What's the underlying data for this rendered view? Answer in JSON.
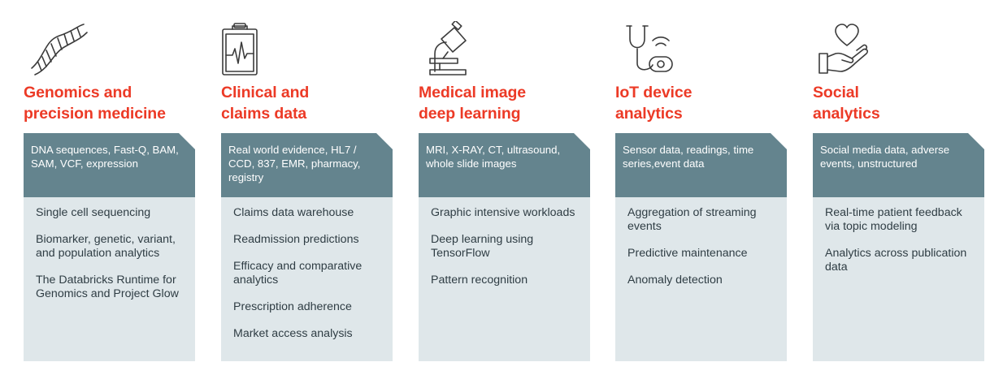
{
  "columns": [
    {
      "id": "genomics",
      "icon": "dna-icon",
      "title_line1": "Genomics and",
      "title_line2": "precision medicine",
      "data_sources": "DNA sequences, Fast-Q, BAM, SAM, VCF, expression",
      "use_cases": [
        "Single cell sequencing",
        "Biomarker, genetic, variant, and population analytics",
        "The Databricks Runtime for Genomics and Project Glow"
      ]
    },
    {
      "id": "clinical",
      "icon": "clipboard-heartbeat-icon",
      "title_line1": "Clinical and",
      "title_line2": "claims data",
      "data_sources": "Real world evidence,  HL7 / CCD, 837, EMR, pharmacy, registry",
      "use_cases": [
        "Claims data warehouse",
        "Readmission predictions",
        "Efficacy and comparative analytics",
        "Prescription adherence",
        "Market access analysis"
      ]
    },
    {
      "id": "imaging",
      "icon": "microscope-icon",
      "title_line1": "Medical image",
      "title_line2": "deep learning",
      "data_sources": "MRI, X-RAY, CT, ultrasound, whole slide images",
      "use_cases": [
        "Graphic intensive workloads",
        "Deep learning using TensorFlow",
        "Pattern recognition"
      ]
    },
    {
      "id": "iot",
      "icon": "stethoscope-wireless-icon",
      "title_line1": "IoT device",
      "title_line2": "analytics",
      "data_sources": "Sensor data, readings, time series,event data",
      "use_cases": [
        "Aggregation of streaming events",
        "Predictive maintenance",
        "Anomaly detection"
      ]
    },
    {
      "id": "social",
      "icon": "hand-heart-icon",
      "title_line1": "Social",
      "title_line2": "analytics",
      "data_sources": "Social media data, adverse events, unstructured",
      "use_cases": [
        "Real-time patient feedback via topic modeling",
        "Analytics across publication data"
      ]
    }
  ]
}
